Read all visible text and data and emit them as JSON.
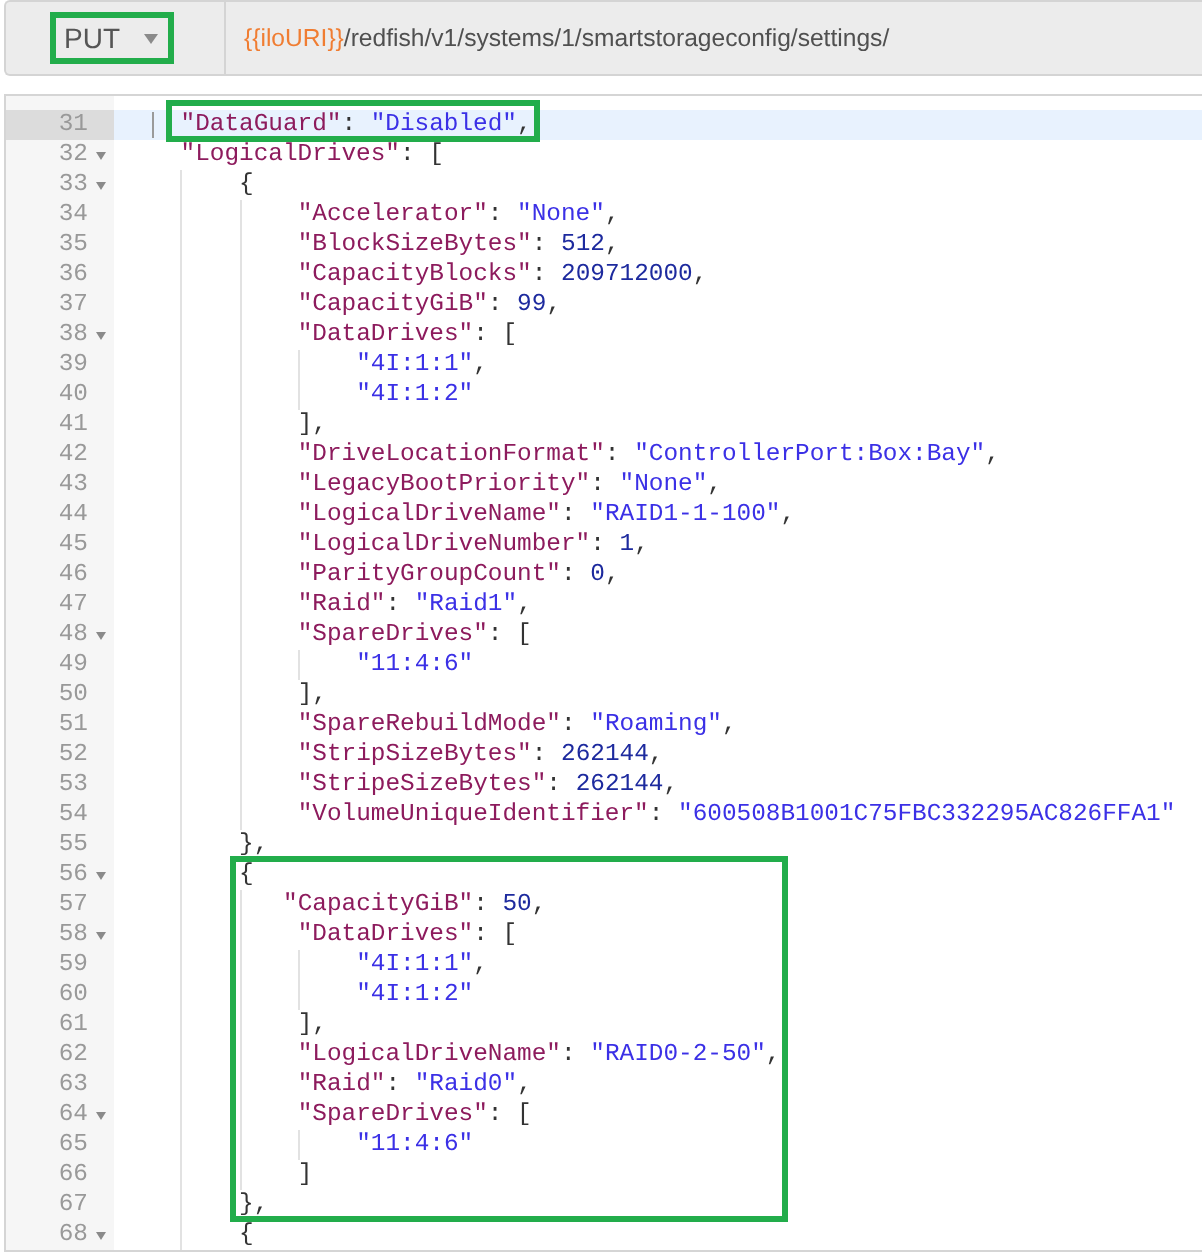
{
  "request": {
    "method": {
      "label": "PUT",
      "boxed": true
    },
    "url": "{{iloURI}}/redfish/v1/systems/1/smartstorageconfig/settings/"
  },
  "editor": {
    "blocks": [
      {
        "boxed": true,
        "lines": [
          {
            "number": "31",
            "text": "    \"DataGuard\": \"Disabled\",",
            "foldable": false,
            "active": true
          }
        ]
      },
      {
        "boxed": false,
        "lines": [
          {
            "number": "32",
            "text": "    \"LogicalDrives\": [",
            "foldable": true,
            "active": false
          },
          {
            "number": "33",
            "text": "        {",
            "foldable": true,
            "active": false
          },
          {
            "number": "34",
            "text": "            \"Accelerator\": \"None\",",
            "foldable": false,
            "active": false
          },
          {
            "number": "35",
            "text": "            \"BlockSizeBytes\": 512,",
            "foldable": false,
            "active": false
          },
          {
            "number": "36",
            "text": "            \"CapacityBlocks\": 209712000,",
            "foldable": false,
            "active": false
          },
          {
            "number": "37",
            "text": "            \"CapacityGiB\": 99,",
            "foldable": false,
            "active": false
          },
          {
            "number": "38",
            "text": "            \"DataDrives\": [",
            "foldable": true,
            "active": false
          },
          {
            "number": "39",
            "text": "                \"4I:1:1\",",
            "foldable": false,
            "active": false
          },
          {
            "number": "40",
            "text": "                \"4I:1:2\"",
            "foldable": false,
            "active": false
          },
          {
            "number": "41",
            "text": "            ],",
            "foldable": false,
            "active": false
          },
          {
            "number": "42",
            "text": "            \"DriveLocationFormat\": \"ControllerPort:Box:Bay\",",
            "foldable": false,
            "active": false
          },
          {
            "number": "43",
            "text": "            \"LegacyBootPriority\": \"None\",",
            "foldable": false,
            "active": false
          },
          {
            "number": "44",
            "text": "            \"LogicalDriveName\": \"RAID1-1-100\",",
            "foldable": false,
            "active": false
          },
          {
            "number": "45",
            "text": "            \"LogicalDriveNumber\": 1,",
            "foldable": false,
            "active": false
          },
          {
            "number": "46",
            "text": "            \"ParityGroupCount\": 0,",
            "foldable": false,
            "active": false
          },
          {
            "number": "47",
            "text": "            \"Raid\": \"Raid1\",",
            "foldable": false,
            "active": false
          },
          {
            "number": "48",
            "text": "            \"SpareDrives\": [",
            "foldable": true,
            "active": false
          },
          {
            "number": "49",
            "text": "                \"11:4:6\"",
            "foldable": false,
            "active": false
          },
          {
            "number": "50",
            "text": "            ],",
            "foldable": false,
            "active": false
          },
          {
            "number": "51",
            "text": "            \"SpareRebuildMode\": \"Roaming\",",
            "foldable": false,
            "active": false
          },
          {
            "number": "52",
            "text": "            \"StripSizeBytes\": 262144,",
            "foldable": false,
            "active": false
          },
          {
            "number": "53",
            "text": "            \"StripeSizeBytes\": 262144,",
            "foldable": false,
            "active": false
          },
          {
            "number": "54",
            "text": "            \"VolumeUniqueIdentifier\": \"600508B1001C75FBC332295AC826FFA1\"",
            "foldable": false,
            "active": false
          },
          {
            "number": "55",
            "text": "        },",
            "foldable": false,
            "active": false
          }
        ]
      },
      {
        "boxed": true,
        "lines": [
          {
            "number": "56",
            "text": "        {",
            "foldable": true,
            "active": false
          },
          {
            "number": "57",
            "text": "           \"CapacityGiB\": 50,",
            "foldable": false,
            "active": false
          },
          {
            "number": "58",
            "text": "            \"DataDrives\": [",
            "foldable": true,
            "active": false
          },
          {
            "number": "59",
            "text": "                \"4I:1:1\",",
            "foldable": false,
            "active": false
          },
          {
            "number": "60",
            "text": "                \"4I:1:2\"",
            "foldable": false,
            "active": false
          },
          {
            "number": "61",
            "text": "            ],",
            "foldable": false,
            "active": false
          },
          {
            "number": "62",
            "text": "            \"LogicalDriveName\": \"RAID0-2-50\",",
            "foldable": false,
            "active": false
          },
          {
            "number": "63",
            "text": "            \"Raid\": \"Raid0\",",
            "foldable": false,
            "active": false
          },
          {
            "number": "64",
            "text": "            \"SpareDrives\": [",
            "foldable": true,
            "active": false
          },
          {
            "number": "65",
            "text": "                \"11:4:6\"",
            "foldable": false,
            "active": false
          },
          {
            "number": "66",
            "text": "            ]",
            "foldable": false,
            "active": false
          },
          {
            "number": "67",
            "text": "        },",
            "foldable": false,
            "active": false
          }
        ]
      },
      {
        "boxed": false,
        "lines": [
          {
            "number": "68",
            "text": "        {",
            "foldable": true,
            "active": false
          }
        ]
      }
    ]
  }
}
